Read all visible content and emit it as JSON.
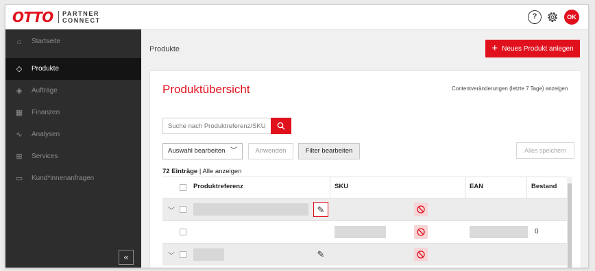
{
  "header": {
    "logo_main": "OTTO",
    "logo_sub_line1": "PARTNER",
    "logo_sub_line2": "CONNECT",
    "help_glyph": "?",
    "avatar_initials": "OK",
    "icons": [
      "help-icon",
      "gear-icon"
    ]
  },
  "sidebar": {
    "items": [
      {
        "label": "Startseite",
        "icon": "home-icon",
        "glyph": "⌂",
        "active": false
      },
      {
        "label": "Produkte",
        "icon": "tag-icon",
        "glyph": "◇",
        "active": true
      },
      {
        "label": "Aufträge",
        "icon": "box-icon",
        "glyph": "◈",
        "active": false
      },
      {
        "label": "Finanzen",
        "icon": "finance-icon",
        "glyph": "▦",
        "active": false
      },
      {
        "label": "Analysen",
        "icon": "analytics-icon",
        "glyph": "∿",
        "active": false
      },
      {
        "label": "Services",
        "icon": "services-icon",
        "glyph": "⊞",
        "active": false
      },
      {
        "label": "Kund*innenanfragen",
        "icon": "chat-icon",
        "glyph": "▭",
        "active": false
      }
    ],
    "collapse_glyph": "«"
  },
  "main": {
    "breadcrumb": "Produkte",
    "new_product_label": "Neues Produkt anlegen",
    "new_product_glyph": "+",
    "title": "Produktübersicht",
    "content_link": "Contentveränderungen (letzte 7 Tage) anzeigen",
    "search_placeholder": "Suche nach Produktreferenz/SKU",
    "select_label": "Auswahl bearbeiten",
    "select_chevron": "﹀",
    "apply_label": "Anwenden",
    "filter_label": "Filter bearbeiten",
    "save_all_label": "Alles speichern",
    "entries_count": "72 Einträge",
    "entries_sep": " | ",
    "entries_show_all": "Alle anzeigen"
  },
  "table": {
    "columns": [
      "Produktreferenz",
      "SKU",
      "EAN",
      "Bestand"
    ],
    "rows": [
      {
        "expand": true,
        "shaded": true,
        "reference": "",
        "sku": "",
        "ean": "",
        "stock": ""
      },
      {
        "expand": false,
        "shaded": false,
        "reference": "",
        "sku": "",
        "ean": "",
        "stock": "0"
      },
      {
        "expand": true,
        "shaded": true,
        "reference": "",
        "sku": "",
        "ean": "",
        "stock": ""
      }
    ],
    "pencil_glyph": "✎"
  },
  "colors": {
    "brand_red": "#e0101d",
    "sidebar_bg": "#2d2d2d",
    "sidebar_active_bg": "#141414"
  }
}
